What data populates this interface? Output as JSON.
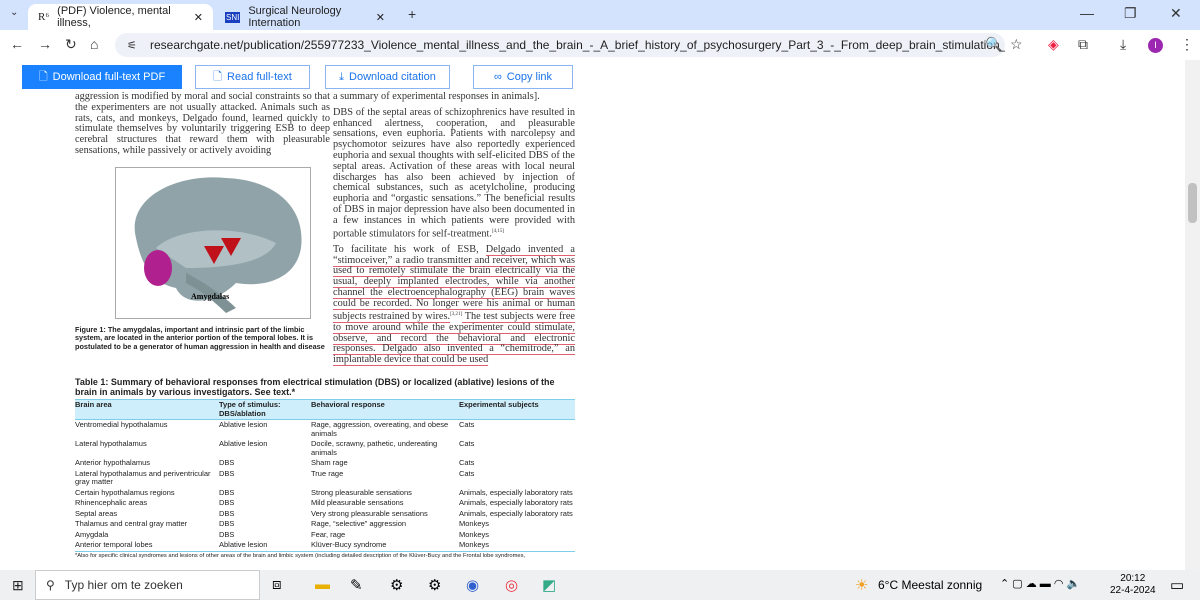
{
  "browser": {
    "tabs": [
      {
        "icon": "R⁶",
        "title": "(PDF) Violence, mental illness,"
      },
      {
        "icon": "SNI",
        "title": "Surgical Neurology Internation"
      }
    ],
    "url": "researchgate.net/publication/255977233_Violence_mental_illness_and_the_brain_-_A_brief_history_of_psychosurgery_Part_3_-_From_deep_brain_stimulation_to_amygdalot...",
    "profile_initial": "I"
  },
  "toolbar": {
    "download_pdf": "Download full-text PDF",
    "read": "Read full-text",
    "citation": "Download citation",
    "copy": "Copy link"
  },
  "doc": {
    "left": "aggression is modified by moral and social constraints so that the experimenters are not usually attacked. Animals such as rats, cats, and monkeys, Delgado found, learned quickly to stimulate themselves by voluntarily triggering ESB to deep cerebral structures that reward them with pleasurable sensations, while passively or actively avoiding",
    "right1": "a summary of experimental responses in animals].",
    "right2": "DBS of the septal areas of schizophrenics have resulted in enhanced alertness, cooperation, and pleasurable sensations, even euphoria. Patients with narcolepsy and psychomotor seizures have also reportedly experienced euphoria and sexual thoughts with self-elicited DBS of the septal areas. Activation of these areas with local neural discharges has also been achieved by injection of chemical substances, such as acetylcholine, producing euphoria and “orgastic sensations.” The beneficial results of DBS in major depression have also been documented in a few instances in which patients were provided with portable stimulators for self-treatment.",
    "ref1": "[4,15]",
    "right3a": "To facilitate his work of ESB, ",
    "right3b": "Delgado invented a “stimoceiver,” a radio transmitter and receiver, which was used to remotely stimulate the brain electrically via the usual, deeply implanted electrodes, while via another channel the electroencephalography (EEG) brain waves could be recorded. No longer were his animal or human subjects restrained by wires.",
    "ref2": "[3,21]",
    "right3c": " The test subjects were free to move around while the experimenter could stimulate, observe, and record the behavioral and electronic responses. Delgado also invented a “chemitrode,” an implantable device that could be used",
    "figure_label": "Amygdalas",
    "caption": "Figure 1: The amygdalas, important and intrinsic part of the limbic system, are located in the anterior portion of the temporal lobes. It is postulated to be a generator of human aggression in health and disease"
  },
  "table": {
    "title": "Table 1: Summary of behavioral responses from electrical stimulation (DBS) or localized (ablative) lesions of the brain in animals by various investigators. See text.*",
    "headers": [
      "Brain area",
      "Type of stimulus: DBS/ablation",
      "Behavioral response",
      "Experimental subjects"
    ],
    "rows": [
      [
        "Ventromedial hypothalamus",
        "Ablative lesion",
        "Rage, aggression, overeating, and obese animals",
        "Cats"
      ],
      [
        "Lateral hypothalamus",
        "Ablative lesion",
        "Docile, scrawny, pathetic, undereating animals",
        "Cats"
      ],
      [
        "Anterior hypothalamus",
        "DBS",
        "Sham rage",
        "Cats"
      ],
      [
        "Lateral hypothalamus and periventricular gray matter",
        "DBS",
        "True rage",
        "Cats"
      ],
      [
        "Certain hypothalamus regions",
        "DBS",
        "Strong pleasurable sensations",
        "Animals, especially laboratory rats"
      ],
      [
        "Rhinencephalic areas",
        "DBS",
        "Mild pleasurable sensations",
        "Animals, especially laboratory rats"
      ],
      [
        "Septal areas",
        "DBS",
        "Very strong pleasurable sensations",
        "Animals, especially laboratory rats"
      ],
      [
        "Thalamus and central gray matter",
        "DBS",
        "Rage, “selective” aggression",
        "Monkeys"
      ],
      [
        "Amygdala",
        "DBS",
        "Fear, rage",
        "Monkeys"
      ],
      [
        "Anterior temporal lobes",
        "Ablative lesion",
        "Klüver-Bucy syndrome",
        "Monkeys"
      ]
    ],
    "footnote": "*Also for specific clinical syndromes and lesions of other areas of the brain and limbic system (including detailed description of the Klüver-Bucy and the Frontal lobe syndromes,"
  },
  "taskbar": {
    "search_placeholder": "Typ hier om te zoeken",
    "weather": "6°C  Meestal zonnig",
    "time": "20:12",
    "date": "22-4-2024"
  }
}
